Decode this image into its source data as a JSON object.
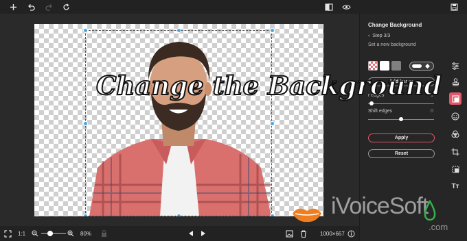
{
  "toolbar": {
    "icons": [
      "plus-icon",
      "undo-icon",
      "redo-icon",
      "reset-icon",
      "compare-icon",
      "eye-icon",
      "save-icon"
    ]
  },
  "canvas": {
    "overlay_title": "Change the Background"
  },
  "bottombar": {
    "fit_label": "1:1",
    "zoom_value": "80%",
    "zoom_fraction": 0.35,
    "image_size": "1000×667"
  },
  "panel": {
    "title": "Change Background",
    "step": "Step 3/3",
    "subtitle": "Set a new background",
    "add_image_label": "Add Image",
    "sliders": [
      {
        "label": "r edges",
        "value": "1",
        "fraction": 0.05
      },
      {
        "label": "Shift edges",
        "value": "0",
        "fraction": 0.5
      }
    ],
    "apply_label": "Apply",
    "reset_label": "Reset",
    "swatch_colors": [
      "transparent-red-grid",
      "#ffffff",
      "#808080"
    ]
  },
  "rail": {
    "icons": [
      "adjust-icon",
      "stamp-icon",
      "background-icon",
      "smile-icon",
      "color-filter-icon",
      "crop-icon",
      "frame-icon",
      "text-icon"
    ],
    "active": "background-icon"
  },
  "watermark": {
    "brand": "iVoiceSoft",
    "domain": ".com"
  },
  "colors": {
    "accent": "#e4576a",
    "handle": "#49a6e6"
  }
}
